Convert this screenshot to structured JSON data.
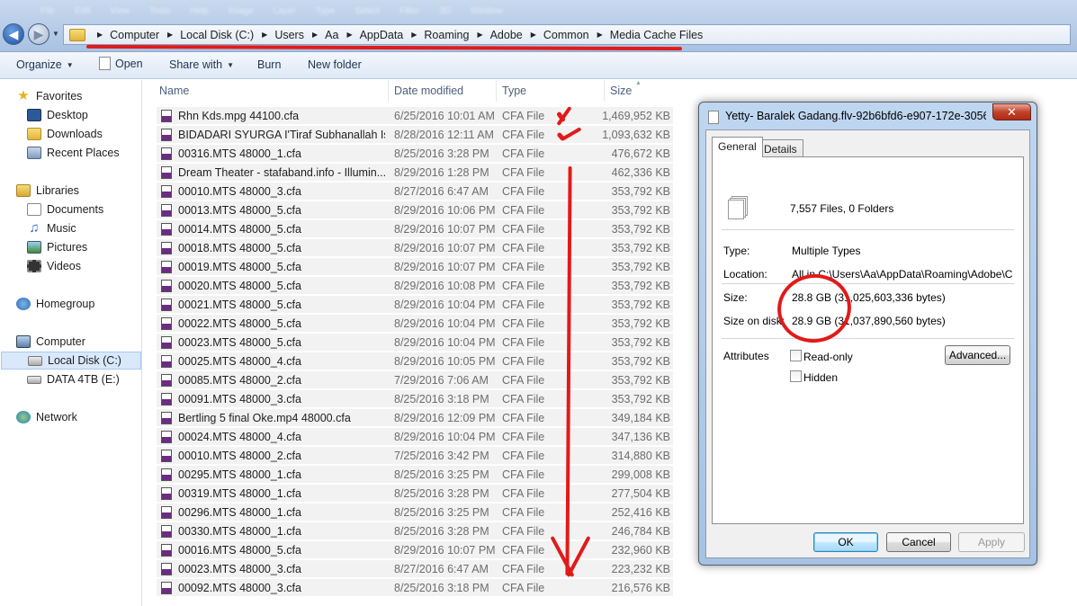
{
  "menu": [
    "File",
    "Edit",
    "View",
    "Tools",
    "Help",
    "Image",
    "Layer",
    "Type",
    "Select",
    "Filter",
    "3D",
    "Window"
  ],
  "address": {
    "crumbs": [
      "Computer",
      "Local Disk (C:)",
      "Users",
      "Aa",
      "AppData",
      "Roaming",
      "Adobe",
      "Common",
      "Media Cache Files"
    ]
  },
  "toolbar": {
    "organize": "Organize",
    "open": "Open",
    "share_with": "Share with",
    "burn": "Burn",
    "new_folder": "New folder"
  },
  "nav": {
    "favorites": "Favorites",
    "desktop": "Desktop",
    "downloads": "Downloads",
    "recent_places": "Recent Places",
    "libraries": "Libraries",
    "documents": "Documents",
    "music": "Music",
    "pictures": "Pictures",
    "videos": "Videos",
    "homegroup": "Homegroup",
    "computer": "Computer",
    "local_disk": "Local Disk (C:)",
    "data_drive": "DATA 4TB (E:)",
    "network": "Network"
  },
  "columns": {
    "name": "Name",
    "date_modified": "Date modified",
    "type": "Type",
    "size": "Size"
  },
  "files": [
    {
      "name": "Rhn Kds.mpg 44100.cfa",
      "date": "6/25/2016 10:01 AM",
      "type": "CFA File",
      "size": "1,469,952 KB"
    },
    {
      "name": "BIDADARI SYURGA I'Tiraf Subhanallah Ist...",
      "date": "8/28/2016 12:11 AM",
      "type": "CFA File",
      "size": "1,093,632 KB"
    },
    {
      "name": "00316.MTS 48000_1.cfa",
      "date": "8/25/2016 3:28 PM",
      "type": "CFA File",
      "size": "476,672 KB"
    },
    {
      "name": "Dream Theater - stafaband.info - Illumin...",
      "date": "8/29/2016 1:28 PM",
      "type": "CFA File",
      "size": "462,336 KB"
    },
    {
      "name": "00010.MTS 48000_3.cfa",
      "date": "8/27/2016 6:47 AM",
      "type": "CFA File",
      "size": "353,792 KB"
    },
    {
      "name": "00013.MTS 48000_5.cfa",
      "date": "8/29/2016 10:06 PM",
      "type": "CFA File",
      "size": "353,792 KB"
    },
    {
      "name": "00014.MTS 48000_5.cfa",
      "date": "8/29/2016 10:07 PM",
      "type": "CFA File",
      "size": "353,792 KB"
    },
    {
      "name": "00018.MTS 48000_5.cfa",
      "date": "8/29/2016 10:07 PM",
      "type": "CFA File",
      "size": "353,792 KB"
    },
    {
      "name": "00019.MTS 48000_5.cfa",
      "date": "8/29/2016 10:07 PM",
      "type": "CFA File",
      "size": "353,792 KB"
    },
    {
      "name": "00020.MTS 48000_5.cfa",
      "date": "8/29/2016 10:08 PM",
      "type": "CFA File",
      "size": "353,792 KB"
    },
    {
      "name": "00021.MTS 48000_5.cfa",
      "date": "8/29/2016 10:04 PM",
      "type": "CFA File",
      "size": "353,792 KB"
    },
    {
      "name": "00022.MTS 48000_5.cfa",
      "date": "8/29/2016 10:04 PM",
      "type": "CFA File",
      "size": "353,792 KB"
    },
    {
      "name": "00023.MTS 48000_5.cfa",
      "date": "8/29/2016 10:04 PM",
      "type": "CFA File",
      "size": "353,792 KB"
    },
    {
      "name": "00025.MTS 48000_4.cfa",
      "date": "8/29/2016 10:05 PM",
      "type": "CFA File",
      "size": "353,792 KB"
    },
    {
      "name": "00085.MTS 48000_2.cfa",
      "date": "7/29/2016 7:06 AM",
      "type": "CFA File",
      "size": "353,792 KB"
    },
    {
      "name": "00091.MTS 48000_3.cfa",
      "date": "8/25/2016 3:18 PM",
      "type": "CFA File",
      "size": "353,792 KB"
    },
    {
      "name": "Bertling 5 final Oke.mp4 48000.cfa",
      "date": "8/29/2016 12:09 PM",
      "type": "CFA File",
      "size": "349,184 KB"
    },
    {
      "name": "00024.MTS 48000_4.cfa",
      "date": "8/29/2016 10:04 PM",
      "type": "CFA File",
      "size": "347,136 KB"
    },
    {
      "name": "00010.MTS 48000_2.cfa",
      "date": "7/25/2016 3:42 PM",
      "type": "CFA File",
      "size": "314,880 KB"
    },
    {
      "name": "00295.MTS 48000_1.cfa",
      "date": "8/25/2016 3:25 PM",
      "type": "CFA File",
      "size": "299,008 KB"
    },
    {
      "name": "00319.MTS 48000_1.cfa",
      "date": "8/25/2016 3:28 PM",
      "type": "CFA File",
      "size": "277,504 KB"
    },
    {
      "name": "00296.MTS 48000_1.cfa",
      "date": "8/25/2016 3:25 PM",
      "type": "CFA File",
      "size": "252,416 KB"
    },
    {
      "name": "00330.MTS 48000_1.cfa",
      "date": "8/25/2016 3:28 PM",
      "type": "CFA File",
      "size": "246,784 KB"
    },
    {
      "name": "00016.MTS 48000_5.cfa",
      "date": "8/29/2016 10:07 PM",
      "type": "CFA File",
      "size": "232,960 KB"
    },
    {
      "name": "00023.MTS 48000_3.cfa",
      "date": "8/27/2016 6:47 AM",
      "type": "CFA File",
      "size": "223,232 KB"
    },
    {
      "name": "00092.MTS 48000_3.cfa",
      "date": "8/25/2016 3:18 PM",
      "type": "CFA File",
      "size": "216,576 KB"
    }
  ],
  "dialog": {
    "title": "Yetty- Baralek Gadang.flv-92b6bfd6-e907-172e-3056...",
    "tab_general": "General",
    "tab_details": "Details",
    "summary": "7,557 Files, 0 Folders",
    "type_label": "Type:",
    "type_value": "Multiple Types",
    "location_label": "Location:",
    "location_value": "All in C:\\Users\\Aa\\AppData\\Roaming\\Adobe\\Comm",
    "size_label": "Size:",
    "size_value": "28.8 GB (31,025,603,336 bytes)",
    "size_on_disk_label": "Size on disk:",
    "size_on_disk_value": "28.9 GB (31,037,890,560 bytes)",
    "attributes_label": "Attributes",
    "readonly_label": "Read-only",
    "hidden_label": "Hidden",
    "advanced_label": "Advanced...",
    "ok_label": "OK",
    "cancel_label": "Cancel",
    "apply_label": "Apply"
  },
  "colors": {
    "annotation_red": "#e21a1a",
    "selection_blue": "#d9e8fa",
    "row_gray": "#f2f2f2"
  }
}
